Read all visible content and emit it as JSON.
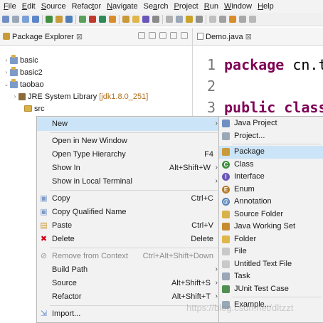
{
  "menubar": {
    "items": [
      {
        "u": "F",
        "rest": "ile"
      },
      {
        "u": "E",
        "rest": "dit"
      },
      {
        "u": "S",
        "rest": "ource"
      },
      {
        "pre": "Refac",
        "u": "t",
        "rest": "or"
      },
      {
        "u": "N",
        "rest": "avigate"
      },
      {
        "pre": "Se",
        "u": "a",
        "rest": "rch"
      },
      {
        "u": "P",
        "rest": "roject"
      },
      {
        "u": "R",
        "rest": "un"
      },
      {
        "u": "W",
        "rest": "indow"
      },
      {
        "u": "H",
        "rest": "elp"
      }
    ]
  },
  "explorer": {
    "title": "Package Explorer",
    "close_glyph": "⊠",
    "tree": [
      {
        "label": "basic",
        "twisty": "›",
        "icon": "project-icon"
      },
      {
        "label": "basic2",
        "twisty": "›",
        "icon": "project-icon"
      },
      {
        "label": "taobao",
        "twisty": "⌄",
        "icon": "project-icon"
      },
      {
        "label": "JRE System Library",
        "version": "[jdk1.8.0_251]",
        "twisty": "›",
        "icon": "library-icon"
      },
      {
        "label": "src",
        "twisty": "",
        "icon": "source-folder-icon"
      }
    ]
  },
  "editor": {
    "tab_name": "Demo.java",
    "close_glyph": "⊠",
    "lines": [
      {
        "no": "1",
        "kw": "package",
        "text": " cn.te"
      },
      {
        "no": "2",
        "kw": "",
        "text": ""
      },
      {
        "no": "3",
        "kw": "public class",
        "text": ""
      }
    ]
  },
  "context_menu": {
    "items": [
      {
        "label": "New",
        "shortcut": "",
        "arrow": "›",
        "selected": true,
        "icon": ""
      },
      {
        "sep": true
      },
      {
        "label": "Open in New Window",
        "shortcut": "",
        "icon": ""
      },
      {
        "label": "Open Type Hierarchy",
        "shortcut": "F4",
        "icon": ""
      },
      {
        "label": "Show In",
        "shortcut": "Alt+Shift+W",
        "arrow": "›",
        "icon": ""
      },
      {
        "label": "Show in Local Terminal",
        "shortcut": "",
        "arrow": "›",
        "icon": ""
      },
      {
        "sep": true
      },
      {
        "label": "Copy",
        "shortcut": "Ctrl+C",
        "icon": "copy-icon"
      },
      {
        "label": "Copy Qualified Name",
        "shortcut": "",
        "icon": "copy-qualified-icon"
      },
      {
        "label": "Paste",
        "shortcut": "Ctrl+V",
        "icon": "paste-icon"
      },
      {
        "label": "Delete",
        "shortcut": "Delete",
        "icon": "delete-icon"
      },
      {
        "sep": true
      },
      {
        "label": "Remove from Context",
        "shortcut": "Ctrl+Alt+Shift+Down",
        "disabled": true,
        "icon": "remove-context-icon"
      },
      {
        "label": "Build Path",
        "shortcut": "",
        "arrow": "›",
        "icon": ""
      },
      {
        "label": "Source",
        "shortcut": "Alt+Shift+S",
        "arrow": "›",
        "icon": ""
      },
      {
        "label": "Refactor",
        "shortcut": "Alt+Shift+T",
        "arrow": "›",
        "icon": ""
      },
      {
        "sep": true
      },
      {
        "label": "Import...",
        "shortcut": "",
        "icon": "import-icon"
      }
    ]
  },
  "submenu": {
    "items": [
      {
        "label": "Java Project",
        "icon": "java-project-icon",
        "color": "#6f8fc4",
        "glyph": ""
      },
      {
        "label": "Project...",
        "icon": "project-wizard-icon",
        "color": "#9aa7b8",
        "glyph": ""
      },
      {
        "sep": true
      },
      {
        "label": "Package",
        "icon": "package-icon",
        "color": "#c99a39",
        "glyph": "",
        "selected": true
      },
      {
        "label": "Class",
        "icon": "class-icon",
        "color": "#3f8f3f",
        "glyph": "C"
      },
      {
        "label": "Interface",
        "icon": "interface-icon",
        "color": "#6a56b8",
        "glyph": "I"
      },
      {
        "label": "Enum",
        "icon": "enum-icon",
        "color": "#b47a2a",
        "glyph": "E"
      },
      {
        "label": "Annotation",
        "icon": "annotation-icon",
        "color": "#4f7fb8",
        "glyph": "@"
      },
      {
        "label": "Source Folder",
        "icon": "source-folder-icon",
        "color": "#d9b14a",
        "glyph": ""
      },
      {
        "label": "Java Working Set",
        "icon": "working-set-icon",
        "color": "#c78b2f",
        "glyph": ""
      },
      {
        "label": "Folder",
        "icon": "folder-icon",
        "color": "#e0b64a",
        "glyph": ""
      },
      {
        "label": "File",
        "icon": "file-icon",
        "color": "#c9c9c9",
        "glyph": ""
      },
      {
        "label": "Untitled Text File",
        "icon": "text-file-icon",
        "color": "#c9c9c9",
        "glyph": ""
      },
      {
        "label": "Task",
        "icon": "task-icon",
        "color": "#9aa7b8",
        "glyph": ""
      },
      {
        "label": "JUnit Test Case",
        "icon": "junit-icon",
        "color": "#4f8f4f",
        "glyph": ""
      },
      {
        "sep": true
      },
      {
        "label": "Example...",
        "icon": "example-icon",
        "color": "#9aa7b8",
        "glyph": ""
      }
    ]
  },
  "watermark": "https://blog.csdn.net/dltzzt"
}
